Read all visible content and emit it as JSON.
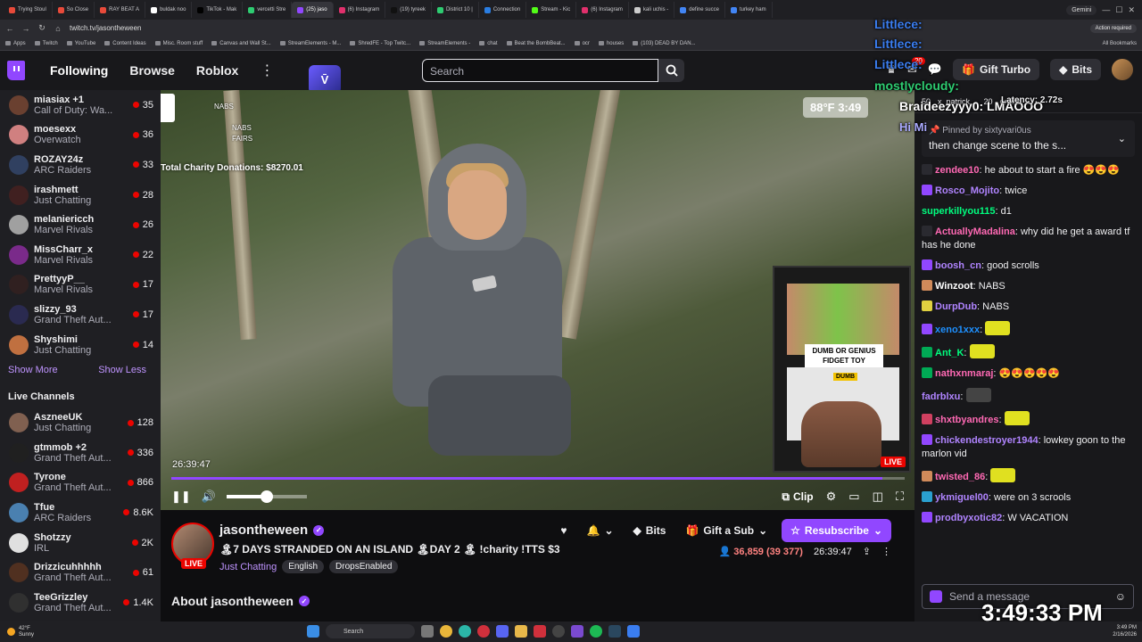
{
  "browser": {
    "tabs": [
      {
        "label": "Trying Stoul",
        "color": "#e84a3a"
      },
      {
        "label": "So Close",
        "color": "#e84a3a"
      },
      {
        "label": "RAY BEAT A",
        "color": "#e84a3a"
      },
      {
        "label": "buldak noo",
        "color": "#ffffff"
      },
      {
        "label": "TikTok - Mak",
        "color": "#000000"
      },
      {
        "label": "vercetti Stre",
        "color": "#2ecc71"
      },
      {
        "label": "(25) jaso",
        "color": "#9147ff"
      },
      {
        "label": "(6) Instagram",
        "color": "#e1306c"
      },
      {
        "label": "(19) tyreek",
        "color": "#111111"
      },
      {
        "label": "District 10 |",
        "color": "#2ecc71"
      },
      {
        "label": "Connection",
        "color": "#2a7de1"
      },
      {
        "label": "Stream - Kic",
        "color": "#53fc18"
      },
      {
        "label": "(6) Instagram",
        "color": "#e1306c"
      },
      {
        "label": "kali uchis -",
        "color": "#cccccc"
      },
      {
        "label": "define succe",
        "color": "#4285f4"
      },
      {
        "label": "turkey ham",
        "color": "#4285f4"
      }
    ],
    "active_tab_index": 6,
    "gemini_label": "Gemini",
    "url": "twitch.tv/jasontheween",
    "action_required": "Action required",
    "bookmarks": [
      "Apps",
      "Twitch",
      "YouTube",
      "Content Ideas",
      "Misc. Room stuff",
      "Canvas and Wall St...",
      "StreamElements - M...",
      "ShredFE - Top Twitc...",
      "StreamElements -",
      "chat",
      "Beat the BombBeat...",
      "ocr",
      "houses",
      "(103) DEAD BY DAN..."
    ],
    "all_bookmarks": "All Bookmarks"
  },
  "topnav": {
    "following": "Following",
    "browse": "Browse",
    "roblox": "Roblox",
    "more": "⋮",
    "ext_badge": "V̄",
    "search_placeholder": "Search",
    "notif_count": "20",
    "gift_turbo": "Gift Turbo",
    "bits": "Bits"
  },
  "sidebar": {
    "followed": [
      {
        "name": "miasiax +1",
        "game": "Call of Duty: Wa...",
        "viewers": "35",
        "color": "#6a4030"
      },
      {
        "name": "moesexx",
        "game": "Overwatch",
        "viewers": "36",
        "color": "#d08080"
      },
      {
        "name": "ROZAY24z",
        "game": "ARC Raiders",
        "viewers": "33",
        "color": "#304060"
      },
      {
        "name": "irashmett",
        "game": "Just Chatting",
        "viewers": "28",
        "color": "#402020"
      },
      {
        "name": "melaniericch",
        "game": "Marvel Rivals",
        "viewers": "26",
        "color": "#a0a0a0"
      },
      {
        "name": "MissCharr_x",
        "game": "Marvel Rivals",
        "viewers": "22",
        "color": "#7a2a8a"
      },
      {
        "name": "PrettyyP__",
        "game": "Marvel Rivals",
        "viewers": "17",
        "color": "#302020"
      },
      {
        "name": "slizzy_93",
        "game": "Grand Theft Aut...",
        "viewers": "17",
        "color": "#2a2a50"
      },
      {
        "name": "Shyshimi",
        "game": "Just Chatting",
        "viewers": "14",
        "color": "#c07040"
      }
    ],
    "show_more": "Show More",
    "show_less": "Show Less",
    "live_heading": "Live Channels",
    "live": [
      {
        "name": "AszneeUK",
        "game": "Just Chatting",
        "viewers": "128",
        "color": "#806050"
      },
      {
        "name": "gtmmob +2",
        "game": "Grand Theft Aut...",
        "viewers": "336",
        "color": "#202020"
      },
      {
        "name": "Tyrone",
        "game": "Grand Theft Aut...",
        "viewers": "866",
        "color": "#c02020"
      },
      {
        "name": "Tfue",
        "game": "ARC Raiders",
        "viewers": "8.6K",
        "color": "#4a80b0"
      },
      {
        "name": "Shotzzy",
        "game": "IRL",
        "viewers": "2K",
        "color": "#e0e0e0"
      },
      {
        "name": "Drizzicuhhhhh",
        "game": "Grand Theft Aut...",
        "viewers": "61",
        "color": "#503020"
      },
      {
        "name": "TeeGrizzley",
        "game": "Grand Theft Aut...",
        "viewers": "1.4K",
        "color": "#303030"
      }
    ]
  },
  "video": {
    "overlay_lines": [
      "NABS",
      "NABS",
      "FAIRS"
    ],
    "donations": "Total Charity Donations: $8270.01",
    "weather": "88°F 3:49",
    "pip_label": "DUMB OR GENIUS FIDGET TOY",
    "pip_tag": "DUMB",
    "pip_live": "LIVE",
    "timecode": "26:39:47",
    "progress": 0.97,
    "volume": 0.5,
    "clip": "Clip"
  },
  "stream": {
    "streamer": "jasontheween",
    "title": "🏝7 DAYS STRANDED ON AN ISLAND 🏝DAY 2 🏝 !charity !TTS $3",
    "category": "Just Chatting",
    "tags": [
      "English",
      "DropsEnabled"
    ],
    "live": "LIVE",
    "bits": "Bits",
    "gift_sub": "Gift a Sub",
    "resubscribe": "Resubscribe",
    "viewers": "36,859 (39 377)",
    "uptime": "26:39:47",
    "about": "About jasontheween"
  },
  "chat": {
    "header_items": [
      "50",
      "x_patrick...",
      "20",
      "omihc"
    ],
    "latency": "Latency: 2.72s",
    "pinned_by": "Pinned by",
    "pinned_user": "sixtyvari0us",
    "pinned_msg": "then change scene to the s...",
    "messages": [
      {
        "user": "zendee10",
        "text": "he about to start a fire 😍😍😍",
        "color": "#ff69b4",
        "badge": "#2a2a30"
      },
      {
        "user": "Rosco_Mojito",
        "text": "twice",
        "color": "#b084ff",
        "badge": "#9147ff"
      },
      {
        "user": "superkillyou115",
        "text": "d1",
        "color": "#00ff7f",
        "badge": ""
      },
      {
        "user": "ActuallyMadalina",
        "text": "why did he get a award tf has he done",
        "color": "#ff69b4",
        "badge": "#2a2a30"
      },
      {
        "user": "boosh_cn",
        "text": "good scrolls",
        "color": "#b084ff",
        "badge": "#9147ff"
      },
      {
        "user": "Winzoot",
        "text": "NABS",
        "color": "#ffffff",
        "badge": "#d08a5a"
      },
      {
        "user": "DurpDub",
        "text": "NABS",
        "color": "#b084ff",
        "badge": "#e0d040"
      },
      {
        "user": "xeno1xxx",
        "text": "",
        "color": "#1e90ff",
        "badge": "#9147ff",
        "emote": "#e0e020"
      },
      {
        "user": "Ant_K",
        "text": "",
        "color": "#00ff7f",
        "badge": "#00aa55",
        "emote": "#e0e020"
      },
      {
        "user": "nathxnmaraj",
        "text": "😍😍😍😍😍",
        "color": "#ff69b4",
        "badge": "#00aa55"
      },
      {
        "user": "fadrblxu",
        "text": "",
        "color": "#b084ff",
        "badge": "",
        "emote": "#444444"
      },
      {
        "user": "shxtbyandres",
        "text": "",
        "color": "#ff69b4",
        "badge": "#d04060",
        "emote": "#e0e020"
      },
      {
        "user": "chickendestroyer1944",
        "text": "lowkey goon to the marlon vid",
        "color": "#b084ff",
        "badge": "#9147ff"
      },
      {
        "user": "twisted_86",
        "text": "",
        "color": "#ff69b4",
        "badge": "#d08a5a",
        "emote": "#e0e020"
      },
      {
        "user": "ykmiguel00",
        "text": "were on 3 scrools",
        "color": "#b084ff",
        "badge": "#2aa0d0"
      },
      {
        "user": "prodbyxotic82",
        "text": "W VACATION",
        "color": "#b084ff",
        "badge": "#9147ff"
      }
    ],
    "input_placeholder": "Send a message"
  },
  "overlays": {
    "littlece": "Littlece:",
    "mostlycloudy": "mostlycloudy:",
    "braideezy": "Braideezyyy0: LMAOOO",
    "hi": "Hi Mi",
    "clock": "3:49:33 PM"
  },
  "taskbar": {
    "temp": "42°F",
    "condition": "Sunny",
    "search": "Search",
    "time": "3:49 PM",
    "date": "2/16/2026"
  }
}
